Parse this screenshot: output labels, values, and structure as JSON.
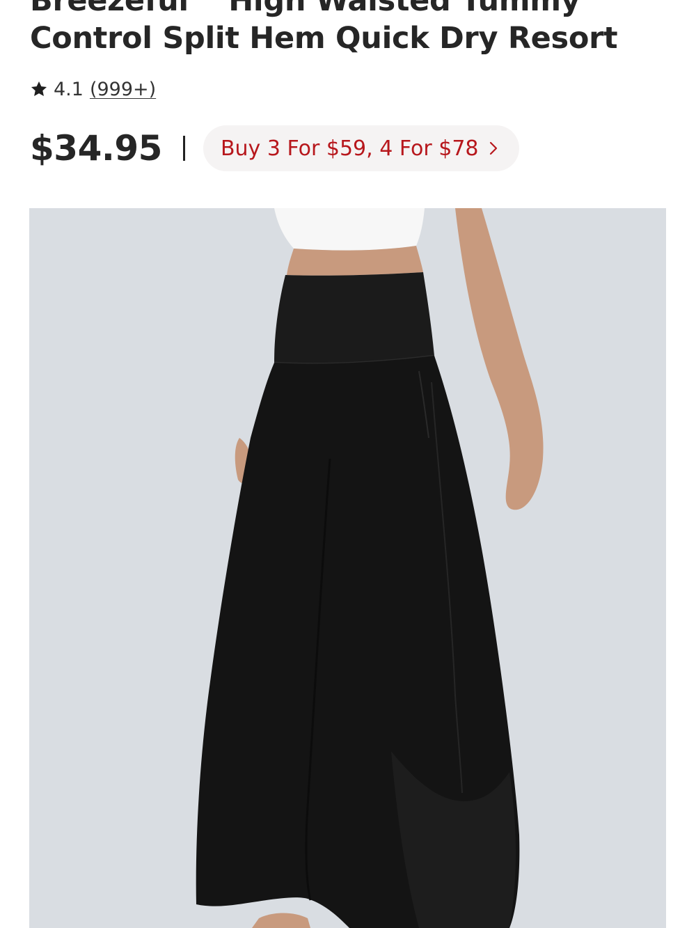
{
  "product": {
    "title_line1": "Breezeful™ High Waisted Tummy",
    "title_line2": "Control Split Hem Quick Dry Resort",
    "rating": "4.1",
    "review_count": "(999+)",
    "price": "$34.95",
    "promo_label": "Buy 3 For $59, 4 For $78",
    "image_icon": "product-photo-black-wide-leg-pants"
  },
  "colors": {
    "promo_text": "#b7171c",
    "promo_bg": "#f5f3f3",
    "image_bg": "#d9dde2"
  }
}
